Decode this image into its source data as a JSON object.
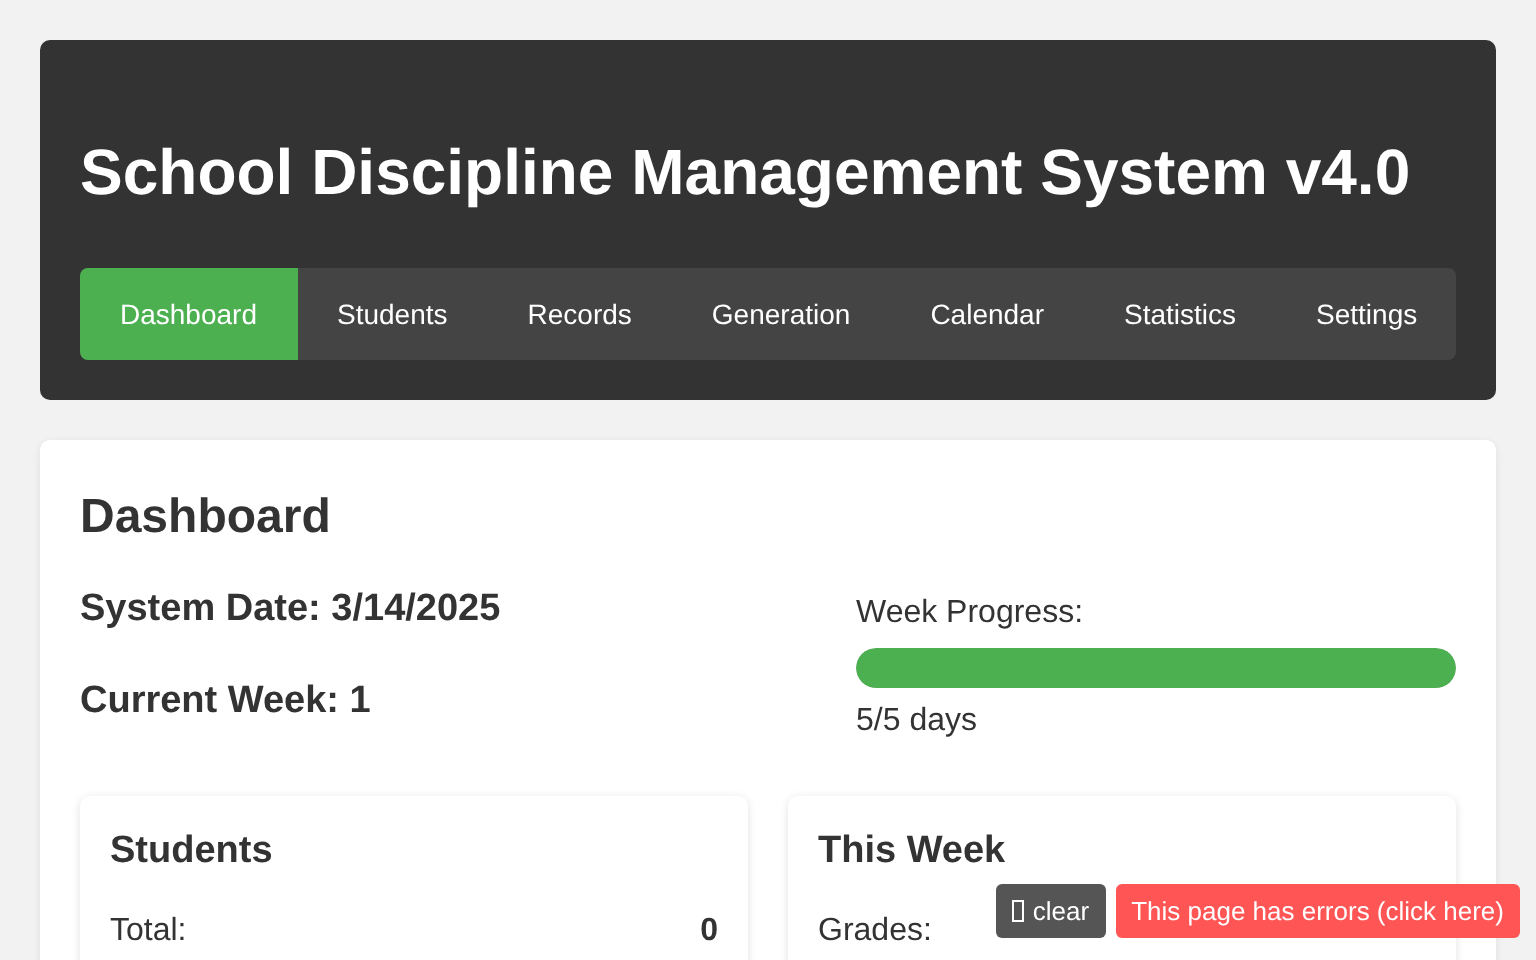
{
  "header": {
    "title": "School Discipline Management System v4.0"
  },
  "tabs": [
    {
      "label": "Dashboard",
      "selected": true
    },
    {
      "label": "Students",
      "selected": false
    },
    {
      "label": "Records",
      "selected": false
    },
    {
      "label": "Generation",
      "selected": false
    },
    {
      "label": "Calendar",
      "selected": false
    },
    {
      "label": "Statistics",
      "selected": false
    },
    {
      "label": "Settings",
      "selected": false
    }
  ],
  "dashboard": {
    "heading": "Dashboard",
    "system_date": "System Date: 3/14/2025",
    "current_week": "Current Week: 1",
    "progress_label": "Week Progress:",
    "level": 1,
    "progress_text": "5/5 days"
  },
  "cards": [
    {
      "title": "Students",
      "rows": [
        {
          "label": "Total:",
          "value": "0"
        }
      ]
    },
    {
      "title": "This Week",
      "rows": [
        {
          "label": "Grades:"
        }
      ]
    }
  ],
  "error_bar": {
    "clear_label": "clear",
    "message": "This page has errors (click here)"
  }
}
